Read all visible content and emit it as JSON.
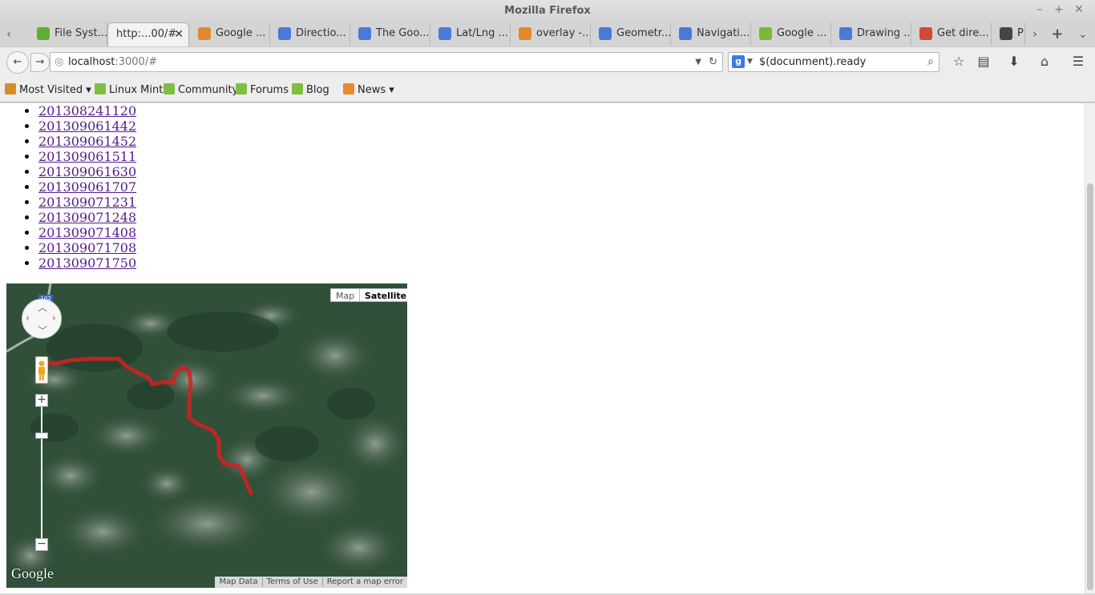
{
  "window": {
    "title": "Mozilla Firefox"
  },
  "tabs": [
    {
      "label": "File Syst...",
      "icon": "green-hexagon-icon",
      "color": "#5cb030"
    },
    {
      "label": "http:...00/#",
      "icon": "blank-page-icon",
      "color": "#f2f2f2"
    },
    {
      "label": "Google ...",
      "icon": "stackoverflow-icon",
      "color": "#e08a2c"
    },
    {
      "label": "Directio...",
      "icon": "google-maps-api-icon",
      "color": "#4a7ad8"
    },
    {
      "label": "The Goo...",
      "icon": "google-maps-api-icon",
      "color": "#4a7ad8"
    },
    {
      "label": "Lat/Lng ...",
      "icon": "google-maps-api-icon",
      "color": "#4a7ad8"
    },
    {
      "label": "overlay -...",
      "icon": "stackoverflow-icon",
      "color": "#e08a2c"
    },
    {
      "label": "Geometr...",
      "icon": "google-maps-api-icon",
      "color": "#4a7ad8"
    },
    {
      "label": "Navigati...",
      "icon": "google-maps-api-icon",
      "color": "#4a7ad8"
    },
    {
      "label": "Google ...",
      "icon": "green-chart-icon",
      "color": "#7ab830"
    },
    {
      "label": "Drawing ...",
      "icon": "google-maps-api-icon",
      "color": "#4a7ad8"
    },
    {
      "label": "Get dire...",
      "icon": "google-g-icon",
      "color": "#d34836"
    },
    {
      "label": "Pla",
      "icon": "footprints-icon",
      "color": "#444444"
    }
  ],
  "nav": {
    "url_host": "localhost",
    "url_rest": ":3000/#",
    "search_value": "$(docunment).ready"
  },
  "bookmarks": [
    {
      "label": "Most Visited",
      "icon": "most-visited-icon",
      "color": "#d98a2a",
      "dropdown": true
    },
    {
      "label": "Linux Mint",
      "icon": "linux-mint-icon",
      "color": "#7fbf3f"
    },
    {
      "label": "Community",
      "icon": "linux-mint-icon",
      "color": "#7fbf3f"
    },
    {
      "label": "Forums",
      "icon": "linux-mint-icon",
      "color": "#7fbf3f"
    },
    {
      "label": "Blog",
      "icon": "linux-mint-icon",
      "color": "#7fbf3f"
    },
    {
      "label": "News",
      "icon": "rss-icon",
      "color": "#e8892a",
      "dropdown": true
    }
  ],
  "dates": [
    "201308241120",
    "201309061442",
    "201309061452",
    "201309061511",
    "201309061630",
    "201309061707",
    "201309071231",
    "201309071248",
    "201309071408",
    "201309071708",
    "201309071750"
  ],
  "map": {
    "type_map": "Map",
    "type_satellite": "Satellite",
    "selected_type": "Satellite",
    "logo": "Google",
    "attribution": [
      "Map Data",
      "Terms of Use",
      "Report a map error"
    ],
    "route_color": "#d42020",
    "route_shield": "102"
  }
}
